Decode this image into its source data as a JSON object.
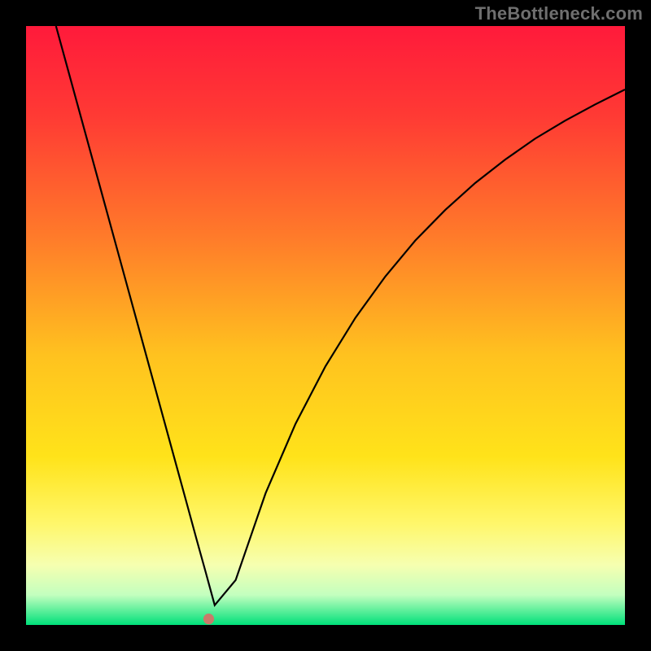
{
  "branding": {
    "watermark": "TheBottleneck.com"
  },
  "chart_data": {
    "type": "line",
    "title": "",
    "xlabel": "",
    "ylabel": "",
    "xlim": [
      0,
      100
    ],
    "ylim": [
      0,
      100
    ],
    "grid": false,
    "legend": false,
    "background_gradient": {
      "stops": [
        {
          "offset": 0.0,
          "color": "#ff1a3b"
        },
        {
          "offset": 0.15,
          "color": "#ff3a34"
        },
        {
          "offset": 0.35,
          "color": "#ff7a2a"
        },
        {
          "offset": 0.55,
          "color": "#ffc21f"
        },
        {
          "offset": 0.72,
          "color": "#ffe31a"
        },
        {
          "offset": 0.83,
          "color": "#fff76a"
        },
        {
          "offset": 0.9,
          "color": "#f6ffb0"
        },
        {
          "offset": 0.95,
          "color": "#c3ffbf"
        },
        {
          "offset": 1.0,
          "color": "#00e07a"
        }
      ]
    },
    "series": [
      {
        "name": "bottleneck-curve",
        "color": "#000000",
        "width": 2.2,
        "x": [
          5,
          7,
          9,
          11,
          13,
          15,
          17,
          19,
          21,
          23,
          25,
          27,
          28.5,
          30,
          31.5,
          35,
          40,
          45,
          50,
          55,
          60,
          65,
          70,
          75,
          80,
          85,
          90,
          95,
          100
        ],
        "y": [
          100,
          92.7,
          85.4,
          78.1,
          70.8,
          63.5,
          56.2,
          48.9,
          41.6,
          34.3,
          27.0,
          19.7,
          14.2,
          8.8,
          3.3,
          7.5,
          22.0,
          33.6,
          43.2,
          51.3,
          58.2,
          64.2,
          69.3,
          73.8,
          77.7,
          81.2,
          84.2,
          86.9,
          89.4
        ]
      }
    ],
    "marker": {
      "name": "min-point",
      "x": 30.5,
      "y": 1.0,
      "color": "#c97a6a",
      "radius": 6
    }
  }
}
